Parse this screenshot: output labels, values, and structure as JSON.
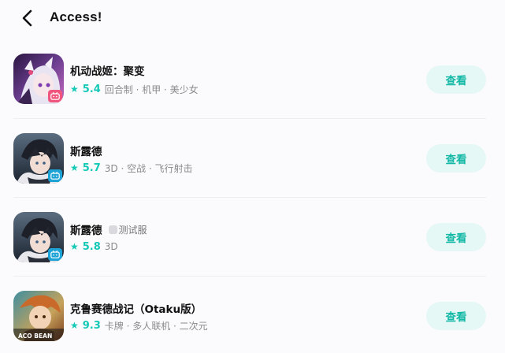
{
  "header": {
    "title": "Access!"
  },
  "colors": {
    "accent": "#14c9b6",
    "button_bg": "#e6f8f6",
    "bilibili_pink": "#f0567d",
    "bilibili_blue": "#1ea3d7"
  },
  "apps": [
    {
      "name": "机动战姬：聚变",
      "rating": "5.4",
      "tags": "回合制 · 机甲 · 美少女",
      "test_label": "",
      "button": "查看",
      "badge": "bilibili-pink-icon"
    },
    {
      "name": "斯露德",
      "rating": "5.7",
      "tags": "3D · 空战 · 飞行射击",
      "test_label": "",
      "button": "查看",
      "badge": "bilibili-blue-icon"
    },
    {
      "name": "斯露德",
      "rating": "5.8",
      "tags": "3D",
      "test_label": "测试服",
      "button": "查看",
      "badge": "bilibili-blue-icon"
    },
    {
      "name": "克鲁赛德战记（Otaku版）",
      "rating": "9.3",
      "tags": "卡牌 · 多人联机 · 二次元",
      "test_label": "",
      "button": "查看",
      "badge": ""
    }
  ]
}
